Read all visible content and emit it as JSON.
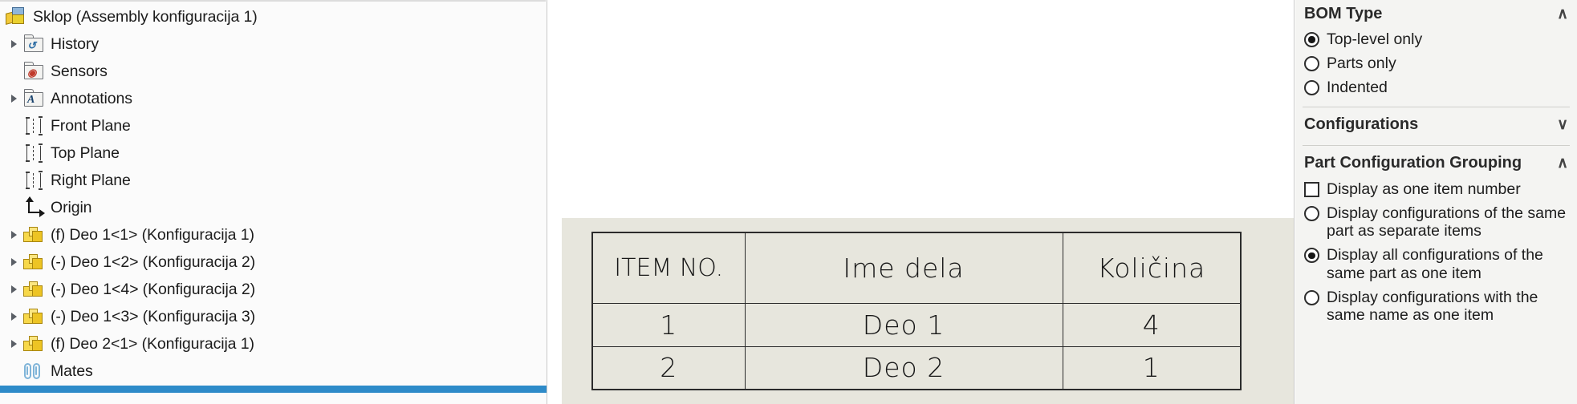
{
  "feature_tree": {
    "items": [
      {
        "label": "Sklop  (Assembly konfiguracija 1)",
        "icon": "assembly-icon",
        "expander": false,
        "indent": 0
      },
      {
        "label": "History",
        "icon": "history-folder-icon",
        "expander": true,
        "indent": 1
      },
      {
        "label": "Sensors",
        "icon": "sensors-folder-icon",
        "expander": false,
        "indent": 1
      },
      {
        "label": "Annotations",
        "icon": "annotations-folder-icon",
        "expander": true,
        "indent": 1
      },
      {
        "label": "Front Plane",
        "icon": "plane-icon",
        "expander": false,
        "indent": 1
      },
      {
        "label": "Top Plane",
        "icon": "plane-icon",
        "expander": false,
        "indent": 1
      },
      {
        "label": "Right Plane",
        "icon": "plane-icon",
        "expander": false,
        "indent": 1
      },
      {
        "label": "Origin",
        "icon": "origin-icon",
        "expander": false,
        "indent": 1
      },
      {
        "label": "(f) Deo 1<1> (Konfiguracija 1)",
        "icon": "part-icon",
        "expander": true,
        "indent": 1
      },
      {
        "label": "(-) Deo 1<2> (Konfiguracija 2)",
        "icon": "part-icon",
        "expander": true,
        "indent": 1
      },
      {
        "label": "(-) Deo 1<4> (Konfiguracija 2)",
        "icon": "part-icon",
        "expander": true,
        "indent": 1
      },
      {
        "label": "(-) Deo 1<3> (Konfiguracija 3)",
        "icon": "part-icon",
        "expander": true,
        "indent": 1
      },
      {
        "label": "(f) Deo 2<1> (Konfiguracija 1)",
        "icon": "part-icon",
        "expander": true,
        "indent": 1
      },
      {
        "label": "Mates",
        "icon": "mates-icon",
        "expander": false,
        "indent": 1
      }
    ],
    "divider_color": "#2e8bc9"
  },
  "drawing": {
    "sheet_color": "#e7e6dd",
    "bom": {
      "columns": [
        "ITEM NO.",
        "Ime dela",
        "Količina"
      ],
      "rows": [
        [
          "1",
          "Deo 1",
          "4"
        ],
        [
          "2",
          "Deo 2",
          "1"
        ]
      ]
    }
  },
  "property_manager": {
    "sections": [
      {
        "title": "BOM Type",
        "chevron": "chevron-up-icon",
        "chevron_glyph": "∧",
        "options": [
          {
            "label": "Top-level only",
            "type": "radio",
            "selected": true
          },
          {
            "label": "Parts only",
            "type": "radio",
            "selected": false
          },
          {
            "label": "Indented",
            "type": "radio",
            "selected": false
          }
        ]
      },
      {
        "title": "Configurations",
        "chevron": "chevron-down-icon",
        "chevron_glyph": "∨",
        "options": []
      },
      {
        "title": "Part Configuration Grouping",
        "chevron": "chevron-up-icon",
        "chevron_glyph": "∧",
        "options": [
          {
            "label": "Display as one item number",
            "type": "checkbox",
            "selected": false
          },
          {
            "label": "Display configurations of the same part as separate items",
            "type": "radio",
            "selected": false
          },
          {
            "label": "Display all configurations of the same part as one item",
            "type": "radio",
            "selected": true
          },
          {
            "label": "Display configurations with the same name as one item",
            "type": "radio",
            "selected": false
          }
        ]
      }
    ]
  }
}
